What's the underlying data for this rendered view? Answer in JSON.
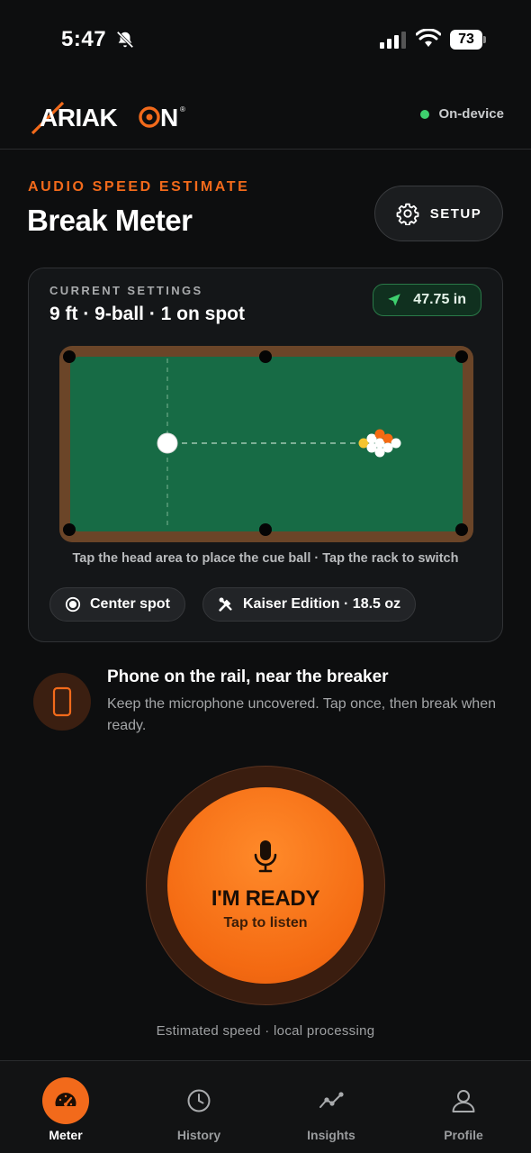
{
  "status": {
    "time": "5:47",
    "battery": "73"
  },
  "header": {
    "brand": "ARIAKON",
    "mode_label": "On-device"
  },
  "hero": {
    "eyebrow": "AUDIO SPEED ESTIMATE",
    "title": "Break Meter",
    "setup_label": "SETUP"
  },
  "settings_card": {
    "label": "CURRENT SETTINGS",
    "value": "9 ft · 9-ball · 1 on spot",
    "distance": "47.75 in",
    "hint": "Tap the head area to place the cue ball · Tap the rack to switch",
    "chips": [
      {
        "label": "Center spot",
        "icon": "target-icon"
      },
      {
        "label": "Kaiser Edition · 18.5 oz",
        "icon": "tools-icon"
      }
    ]
  },
  "instruction": {
    "title": "Phone on the rail, near the breaker",
    "body": "Keep the microphone uncovered. Tap once, then break when ready."
  },
  "ready_button": {
    "main": "I'M READY",
    "sub": "Tap to listen"
  },
  "footnote": "Estimated speed · local processing",
  "tabs": [
    {
      "label": "Meter",
      "icon": "speedometer-icon",
      "active": true
    },
    {
      "label": "History",
      "icon": "clock-icon",
      "active": false
    },
    {
      "label": "Insights",
      "icon": "trend-icon",
      "active": false
    },
    {
      "label": "Profile",
      "icon": "person-icon",
      "active": false
    }
  ],
  "colors": {
    "accent": "#f26a1b",
    "felt": "#176b45",
    "rail": "#6b4528",
    "status_green": "#3ecf6e"
  }
}
